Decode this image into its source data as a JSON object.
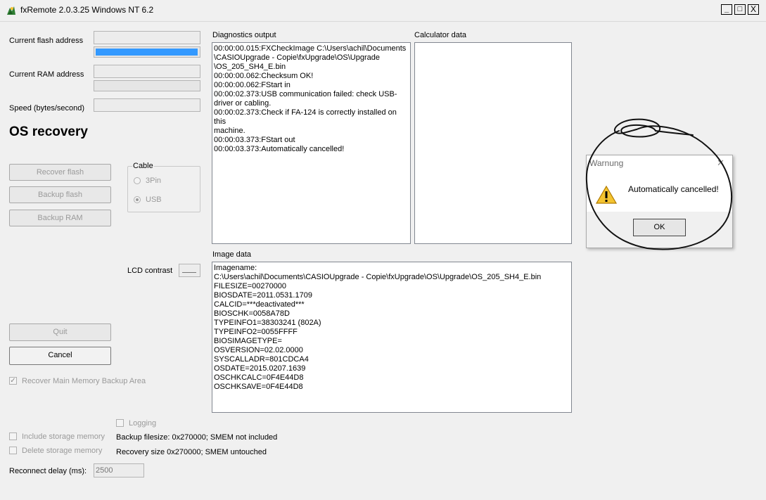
{
  "window": {
    "title": "fxRemote 2.0.3.25 Windows NT 6.2",
    "minimize": "_",
    "maximize": "□",
    "close": "X"
  },
  "left": {
    "flash_address_label": "Current flash address",
    "ram_address_label": "Current RAM address",
    "speed_label": "Speed (bytes/second)",
    "mode_title": "OS recovery",
    "recover_flash": "Recover flash",
    "backup_flash": "Backup flash",
    "backup_ram": "Backup RAM",
    "cable_group_title": "Cable",
    "cable_3pin": "3Pin",
    "cable_usb": "USB",
    "lcd_contrast_label": "LCD contrast",
    "quit": "Quit",
    "cancel": "Cancel",
    "recover_main_memory": "Recover Main Memory Backup Area",
    "logging": "Logging",
    "include_storage": "Include storage memory",
    "delete_storage": "Delete storage memory",
    "backup_filesize": "Backup filesize: 0x270000; SMEM not included",
    "recovery_size": "Recovery size 0x270000; SMEM untouched",
    "reconnect_delay_label": "Reconnect delay (ms):",
    "reconnect_delay_value": "2500"
  },
  "diagnostics": {
    "title": "Diagnostics output",
    "lines": [
      "00:00:00.015:FXCheckImage C:\\Users\\achil\\Documents\n\\CASIOUpgrade - Copie\\fxUpgrade\\OS\\Upgrade\n\\OS_205_SH4_E.bin",
      "00:00:00.062:Checksum OK!",
      "00:00:00.062:FStart in",
      "00:00:02.373:USB communication failed: check USB-\ndriver or cabling.",
      "00:00:02.373:Check if FA-124 is correctly installed on this\nmachine.",
      "00:00:03.373:FStart out",
      "00:00:03.373:Automatically cancelled!"
    ]
  },
  "calculator": {
    "title": "Calculator data"
  },
  "image_data": {
    "title": "Image data",
    "lines": [
      "Imagename:",
      "C:\\Users\\achil\\Documents\\CASIOUpgrade - Copie\\fxUpgrade\\OS\\Upgrade\\OS_205_SH4_E.bin",
      "FILESIZE=00270000",
      "BIOSDATE=2011.0531.1709",
      "CALCID=***deactivated***",
      "BIOSCHK=0058A78D",
      "TYPEINFO1=38303241 (802A)",
      "TYPEINFO2=0055FFFF",
      "BIOSIMAGETYPE=",
      "OSVERSION=02.02.0000",
      "SYSCALLADR=801CDCA4",
      "OSDATE=2015.0207.1639",
      "OSCHKCALC=0F4E44D8",
      "OSCHKSAVE=0F4E44D8"
    ]
  },
  "dialog": {
    "title": "Warnung",
    "message": "Automatically cancelled!",
    "ok": "OK",
    "close": "✕"
  },
  "colors": {
    "progress": "#3399ff",
    "annotation_ink": "#111111"
  }
}
